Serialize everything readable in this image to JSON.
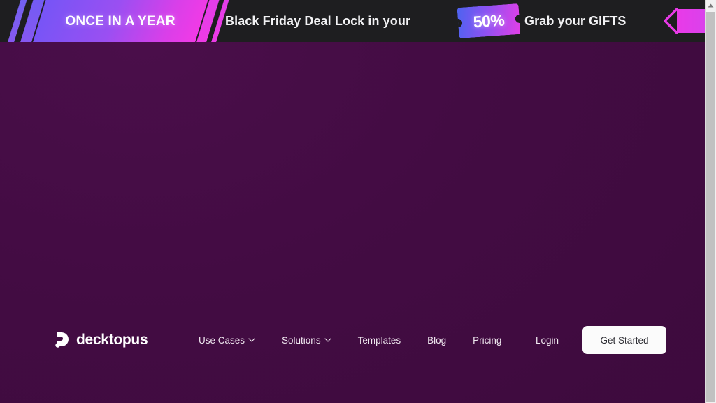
{
  "banner": {
    "badge_label": "ONCE IN A YEAR",
    "headline": "Black Friday Deal Lock in your",
    "discount": "50%",
    "cta_text": "Grab your GIFTS",
    "chevron_icon": "chevron-left-icon",
    "arrow_icon": "arrow-left-block-icon",
    "ticket_icon": "ticket-icon",
    "colors": {
      "bar_background": "#1e1e20",
      "gradient_start": "#7655f6",
      "gradient_end": "#f23ae6",
      "text": "#f2f2f4"
    }
  },
  "nav": {
    "brand": {
      "name": "decktopus",
      "logo_icon": "decktopus-logo-icon"
    },
    "links": [
      {
        "label": "Use Cases",
        "has_dropdown": true,
        "caret_icon": "chevron-down-icon"
      },
      {
        "label": "Solutions",
        "has_dropdown": true,
        "caret_icon": "chevron-down-icon"
      },
      {
        "label": "Templates",
        "has_dropdown": false
      },
      {
        "label": "Blog",
        "has_dropdown": false
      },
      {
        "label": "Pricing",
        "has_dropdown": false
      }
    ],
    "login_label": "Login",
    "cta_label": "Get Started",
    "colors": {
      "background": "#420b42",
      "link_text": "#efe7ef",
      "cta_background": "#fbfbfb",
      "cta_text": "#2d2d33"
    }
  },
  "page": {
    "background_color": "#3f0b3f"
  },
  "scrollbar": {
    "up_arrow_icon": "scroll-up-arrow-icon",
    "track_color": "#f1f1f1",
    "thumb_color": "#c1c1c1"
  }
}
